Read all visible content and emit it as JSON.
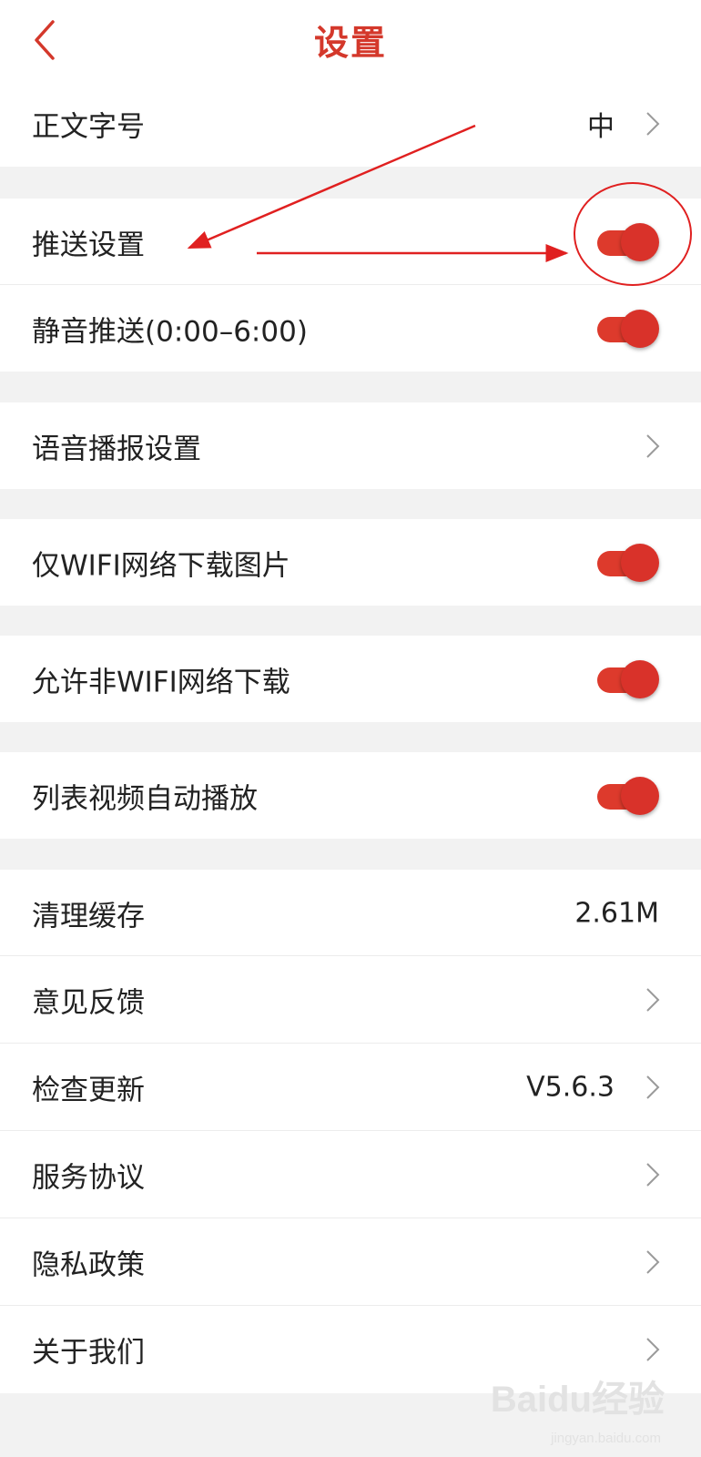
{
  "header": {
    "title": "设置",
    "back_icon": "chevron-left-icon"
  },
  "rows": {
    "font_size": {
      "label": "正文字号",
      "value": "中"
    },
    "push_settings": {
      "label": "推送设置",
      "toggle_on": true
    },
    "silent_push": {
      "label": "静音推送(0:00–6:00)",
      "toggle_on": true
    },
    "voice_broadcast": {
      "label": "语音播报设置"
    },
    "wifi_only_images": {
      "label": "仅WIFI网络下载图片",
      "toggle_on": true
    },
    "allow_non_wifi": {
      "label": "允许非WIFI网络下载",
      "toggle_on": true
    },
    "autoplay_video": {
      "label": "列表视频自动播放",
      "toggle_on": true
    },
    "clear_cache": {
      "label": "清理缓存",
      "value": "2.61M"
    },
    "feedback": {
      "label": "意见反馈"
    },
    "check_update": {
      "label": "检查更新",
      "value": "V5.6.3"
    },
    "service_agreement": {
      "label": "服务协议"
    },
    "privacy_policy": {
      "label": "隐私政策"
    },
    "about_us": {
      "label": "关于我们"
    }
  },
  "colors": {
    "accent": "#d4382b",
    "toggle": "#dd3a2c",
    "background": "#f2f2f2"
  },
  "watermark": {
    "text": "Baidu经验",
    "sub": "jingyan.baidu.com"
  }
}
